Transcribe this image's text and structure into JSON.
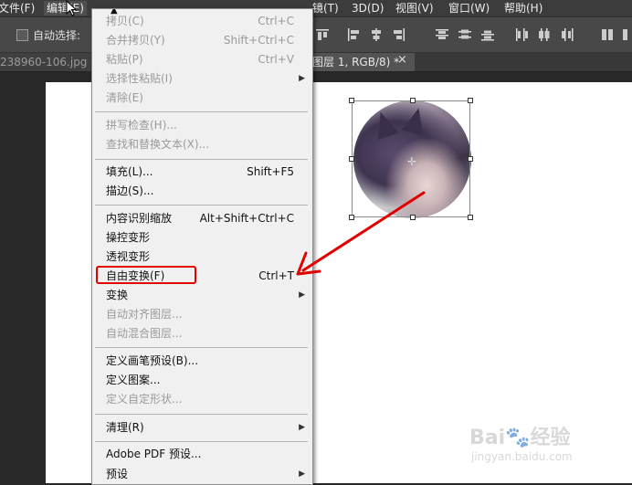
{
  "menubar": {
    "items": [
      {
        "label": "文件(F)",
        "active": false
      },
      {
        "label": "编辑(E)",
        "active": true
      },
      {
        "label": "镜(T)",
        "active": false
      },
      {
        "label": "3D(D)",
        "active": false
      },
      {
        "label": "视图(V)",
        "active": false
      },
      {
        "label": "窗口(W)",
        "active": false
      },
      {
        "label": "帮助(H)",
        "active": false
      }
    ]
  },
  "options": {
    "auto_select_label": "自动选择:",
    "auto_select_checked": false
  },
  "tabs": {
    "inactive_label": "238960-106.jpg @",
    "active_label": "图层 1, RGB/8) *",
    "close_glyph": "×"
  },
  "edit_menu": {
    "items": [
      {
        "label": "拷贝(C)",
        "shortcut": "Ctrl+C",
        "disabled": true
      },
      {
        "label": "合并拷贝(Y)",
        "shortcut": "Shift+Ctrl+C",
        "disabled": true
      },
      {
        "label": "粘贴(P)",
        "shortcut": "Ctrl+V",
        "disabled": true
      },
      {
        "label": "选择性粘贴(I)",
        "shortcut": "",
        "disabled": true,
        "submenu": true
      },
      {
        "label": "清除(E)",
        "shortcut": "",
        "disabled": true
      },
      {
        "label": "拼写检查(H)...",
        "shortcut": "",
        "disabled": true
      },
      {
        "label": "查找和替换文本(X)...",
        "shortcut": "",
        "disabled": true
      },
      {
        "label": "填充(L)...",
        "shortcut": "Shift+F5",
        "disabled": false
      },
      {
        "label": "描边(S)...",
        "shortcut": "",
        "disabled": false
      },
      {
        "label": "内容识别缩放",
        "shortcut": "Alt+Shift+Ctrl+C",
        "disabled": false
      },
      {
        "label": "操控变形",
        "shortcut": "",
        "disabled": false
      },
      {
        "label": "透视变形",
        "shortcut": "",
        "disabled": false
      },
      {
        "label": "自由变换(F)",
        "shortcut": "Ctrl+T",
        "disabled": false,
        "highlighted": true
      },
      {
        "label": "变换",
        "shortcut": "",
        "disabled": false,
        "submenu": true
      },
      {
        "label": "自动对齐图层...",
        "shortcut": "",
        "disabled": true
      },
      {
        "label": "自动混合图层...",
        "shortcut": "",
        "disabled": true
      },
      {
        "label": "定义画笔预设(B)...",
        "shortcut": "",
        "disabled": false
      },
      {
        "label": "定义图案...",
        "shortcut": "",
        "disabled": false
      },
      {
        "label": "定义自定形状...",
        "shortcut": "",
        "disabled": true
      },
      {
        "label": "清理(R)",
        "shortcut": "",
        "disabled": false,
        "submenu": true
      },
      {
        "label": "Adobe PDF 预设...",
        "shortcut": "",
        "disabled": false
      },
      {
        "label": "预设",
        "shortcut": "",
        "disabled": false,
        "submenu": true
      }
    ]
  },
  "watermark": {
    "logo": "Bai🐾经验",
    "url": "jingyan.baidu.com"
  },
  "colors": {
    "annotation": "#e00000",
    "menu_bg": "#f0f0f0",
    "disabled_text": "#9a9a9a"
  },
  "icons": [
    "cursor-arrow-icon",
    "submenu-arrow-icon",
    "scroll-up-icon",
    "align-icons",
    "crosshair-icon"
  ]
}
